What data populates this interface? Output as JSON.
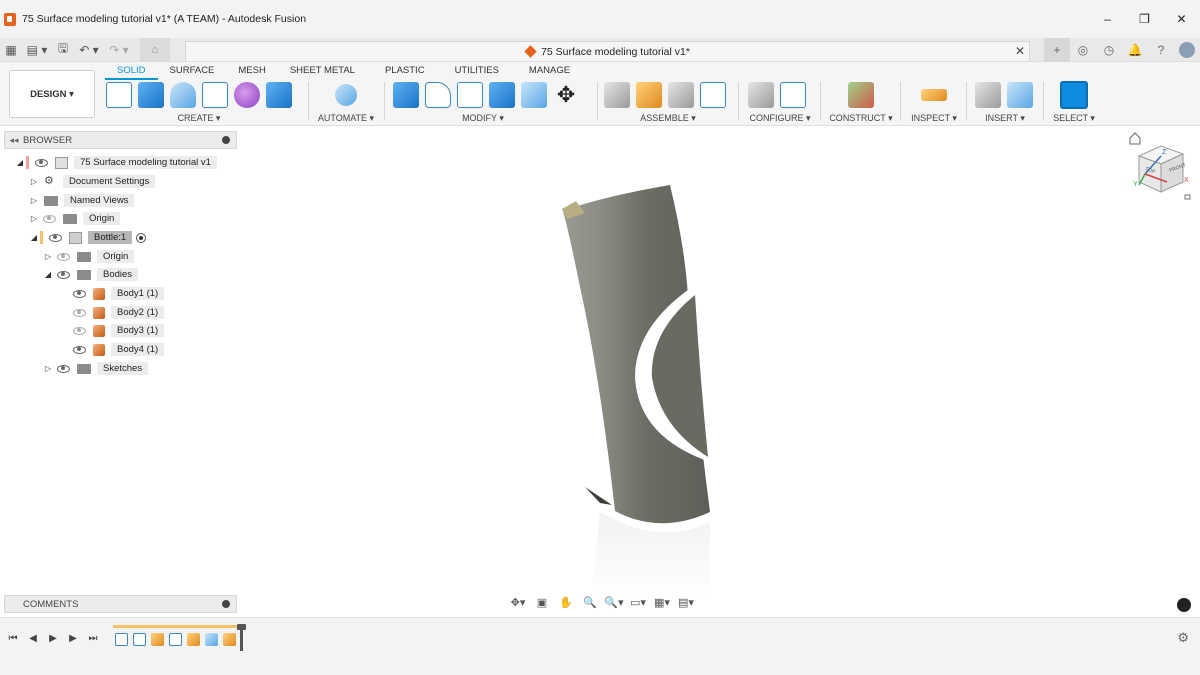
{
  "window": {
    "title": "75 Surface modeling tutorial v1* (A TEAM) - Autodesk Fusion",
    "minimize": "–",
    "restore": "❐",
    "close": "✕"
  },
  "doc_tab": {
    "title": "75 Surface modeling tutorial v1*",
    "close": "✕"
  },
  "quick_access": {
    "grid": "▦",
    "file": "▤ ▾",
    "save": "🖫",
    "undo": "↶ ▾",
    "redo": "↷ ▾",
    "home": "⌂",
    "plus": "+",
    "extensions": "◎",
    "jobs": "◷",
    "notifications": "🔔",
    "help": "?"
  },
  "toolbar": {
    "design_label": "DESIGN ▾",
    "tabs": [
      {
        "label": "SOLID",
        "active": true
      },
      {
        "label": "SURFACE",
        "active": false
      },
      {
        "label": "MESH",
        "active": false
      },
      {
        "label": "SHEET METAL",
        "active": false
      },
      {
        "label": "PLASTIC",
        "active": false
      },
      {
        "label": "UTILITIES",
        "active": false
      },
      {
        "label": "MANAGE",
        "active": false
      }
    ],
    "groups": {
      "create": "CREATE ▾",
      "automate": "AUTOMATE ▾",
      "modify": "MODIFY ▾",
      "assemble": "ASSEMBLE ▾",
      "configure": "CONFIGURE ▾",
      "construct": "CONSTRUCT ▾",
      "inspect": "INSPECT ▾",
      "insert": "INSERT ▾",
      "select": "SELECT ▾"
    }
  },
  "browser": {
    "header": "BROWSER",
    "collapse": "◂◂",
    "root": "75 Surface modeling tutorial v1",
    "items": {
      "document_settings": "Document Settings",
      "named_views": "Named Views",
      "origin": "Origin",
      "component": "Bottle:1",
      "comp_origin": "Origin",
      "bodies": "Bodies",
      "body1": "Body1 (1)",
      "body2": "Body2 (1)",
      "body3": "Body3 (1)",
      "body4": "Body4 (1)",
      "sketches": "Sketches"
    }
  },
  "comments": {
    "header": "COMMENTS"
  },
  "viewcube": {
    "front": "FRONT",
    "top": "TOP",
    "axis_z": "Z",
    "axis_x": "X",
    "axis_y": "Y"
  },
  "navbar": {
    "orbit": "✥▾",
    "look": "▣",
    "pan": "✋",
    "zoom": "🔍",
    "fit": "🔍▾",
    "display": "▭▾",
    "grid": "▦▾",
    "viewports": "▤▾"
  },
  "timeline": {
    "first": "⏮",
    "prev": "◀",
    "play": "▶",
    "next": "▶",
    "last": "⏭",
    "settings": "⚙"
  }
}
